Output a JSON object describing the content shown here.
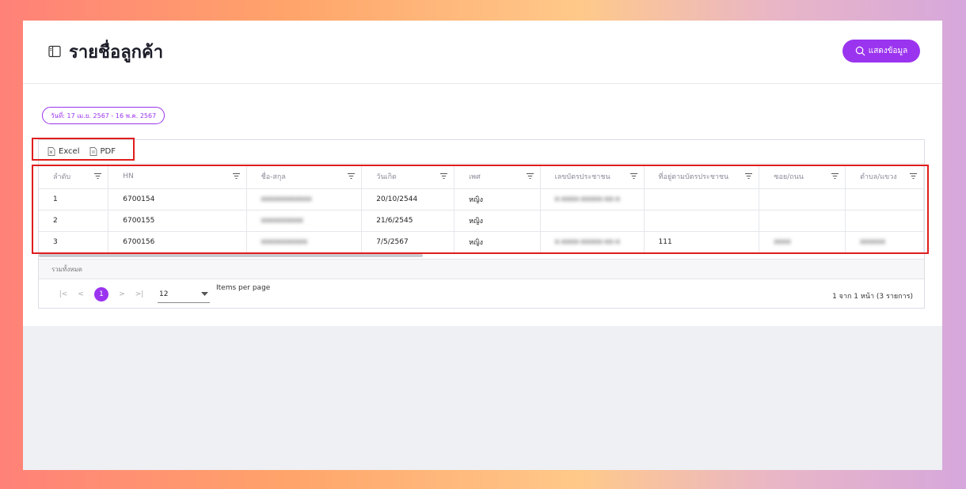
{
  "header": {
    "title": "รายชื่อลูกค้า",
    "show_button_label": "แสดงข้อมูล"
  },
  "filters": {
    "date_range": "วันที่: 17 เม.ย. 2567 - 16 พ.ค. 2567"
  },
  "toolbar": {
    "excel_label": "Excel",
    "pdf_label": "PDF"
  },
  "table": {
    "columns": [
      "ลำดับ",
      "HN",
      "ชื่อ-สกุล",
      "วันเกิด",
      "เพศ",
      "เลขบัตรประชาชน",
      "ที่อยู่ตามบัตรประชาชน",
      "ซอย/ถนน",
      "ตำบล/แขวง"
    ],
    "rows": [
      [
        "1",
        "6700154",
        "xxxxxxxxxxxx",
        "20/10/2544",
        "หญิง",
        "x-xxxx-xxxxx-xx-x",
        "",
        "",
        ""
      ],
      [
        "2",
        "6700155",
        "xxxxxxxxxx",
        "21/6/2545",
        "หญิง",
        "",
        "",
        "",
        ""
      ],
      [
        "3",
        "6700156",
        "xxxxxxxxxxx",
        "7/5/2567",
        "หญิง",
        "x-xxxx-xxxxx-xx-x",
        "111",
        "xxxx",
        "xxxxxx"
      ]
    ],
    "total_label": "รวมทั้งหมด"
  },
  "pagination": {
    "first_icon": "first-page-icon",
    "prev_icon": "prev-page-icon",
    "current_page": "1",
    "next_icon": "next-page-icon",
    "last_icon": "last-page-icon",
    "page_size": "12",
    "page_size_label": "Items per page",
    "info": "1 จาก 1 หน้า (3 รายการ)"
  },
  "colors": {
    "accent": "#9b34ef",
    "highlight": "#e01d1d"
  }
}
